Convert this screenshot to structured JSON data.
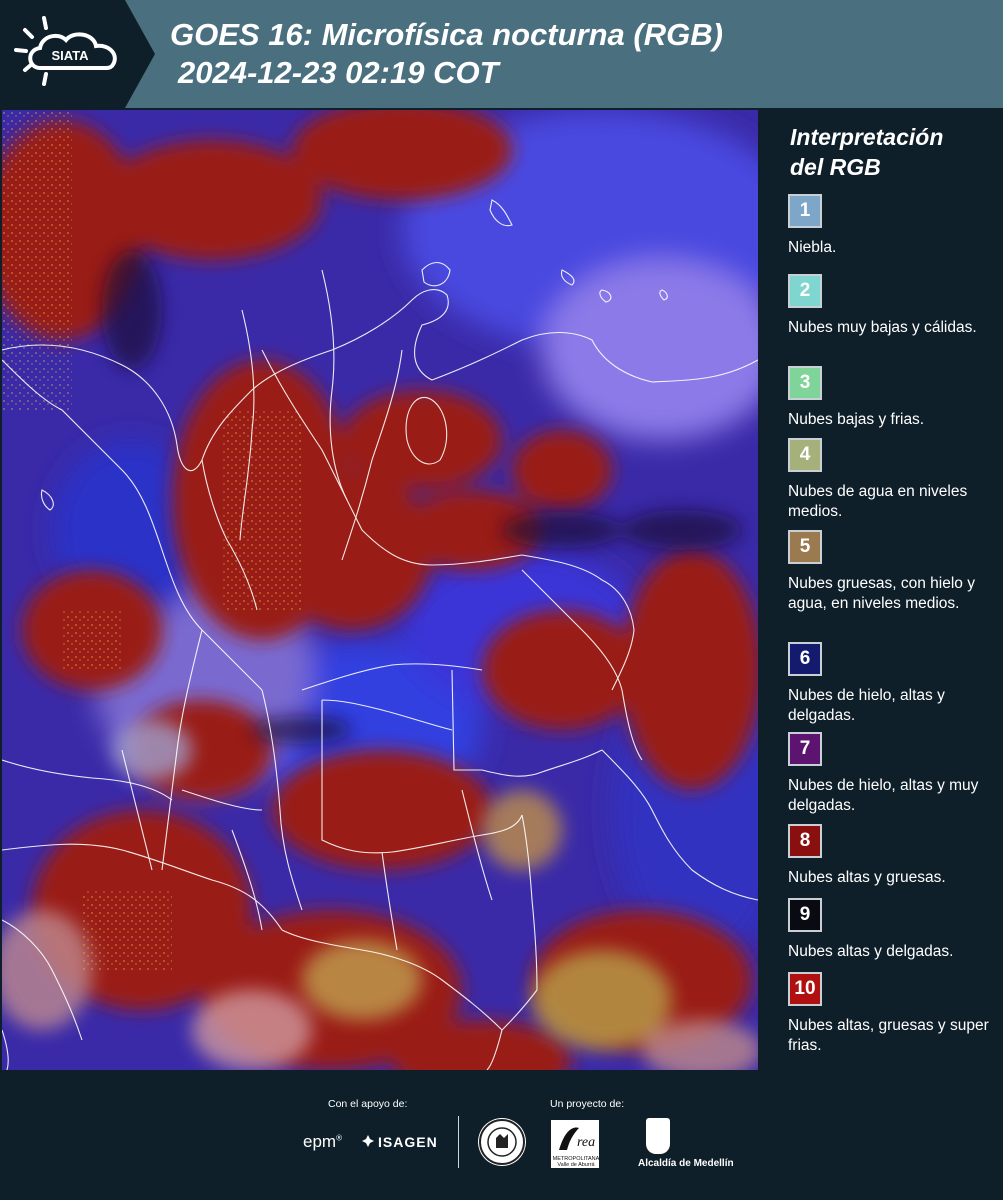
{
  "header": {
    "title_line1": "GOES 16: Microfísica nocturna (RGB)",
    "title_line2": "2024-12-23 02:19 COT",
    "logo_text": "SIATA"
  },
  "legend": {
    "title_line1": "Interpretación",
    "title_line2": "del RGB",
    "items": [
      {
        "num": "1",
        "color": "#7ea6c8",
        "text": "Niebla."
      },
      {
        "num": "2",
        "color": "#7fd6d0",
        "text": "Nubes muy bajas y cálidas."
      },
      {
        "num": "3",
        "color": "#7fd49a",
        "text": "Nubes bajas y frias."
      },
      {
        "num": "4",
        "color": "#a5b07a",
        "text": "Nubes de agua en niveles medios."
      },
      {
        "num": "5",
        "color": "#9a7a4e",
        "text": "Nubes gruesas, con hielo y agua, en niveles medios."
      },
      {
        "num": "6",
        "color": "#141a6e",
        "text": "Nubes de hielo, altas y delgadas."
      },
      {
        "num": "7",
        "color": "#5c1470",
        "text": "Nubes de hielo, altas y muy delgadas."
      },
      {
        "num": "8",
        "color": "#8a1010",
        "text": "Nubes altas y gruesas."
      },
      {
        "num": "9",
        "color": "#0a0a12",
        "text": "Nubes altas y delgadas."
      },
      {
        "num": "10",
        "color": "#b01010",
        "text": "Nubes altas, gruesas y super frias."
      }
    ]
  },
  "footer": {
    "support_label": "Con el apoyo de:",
    "project_label": "Un proyecto de:",
    "epm": "epm",
    "isagen": "ISAGEN",
    "area_text": "METROPOLITANA Valle de Aburrá",
    "medellin": "Alcaldía de Medellín"
  }
}
